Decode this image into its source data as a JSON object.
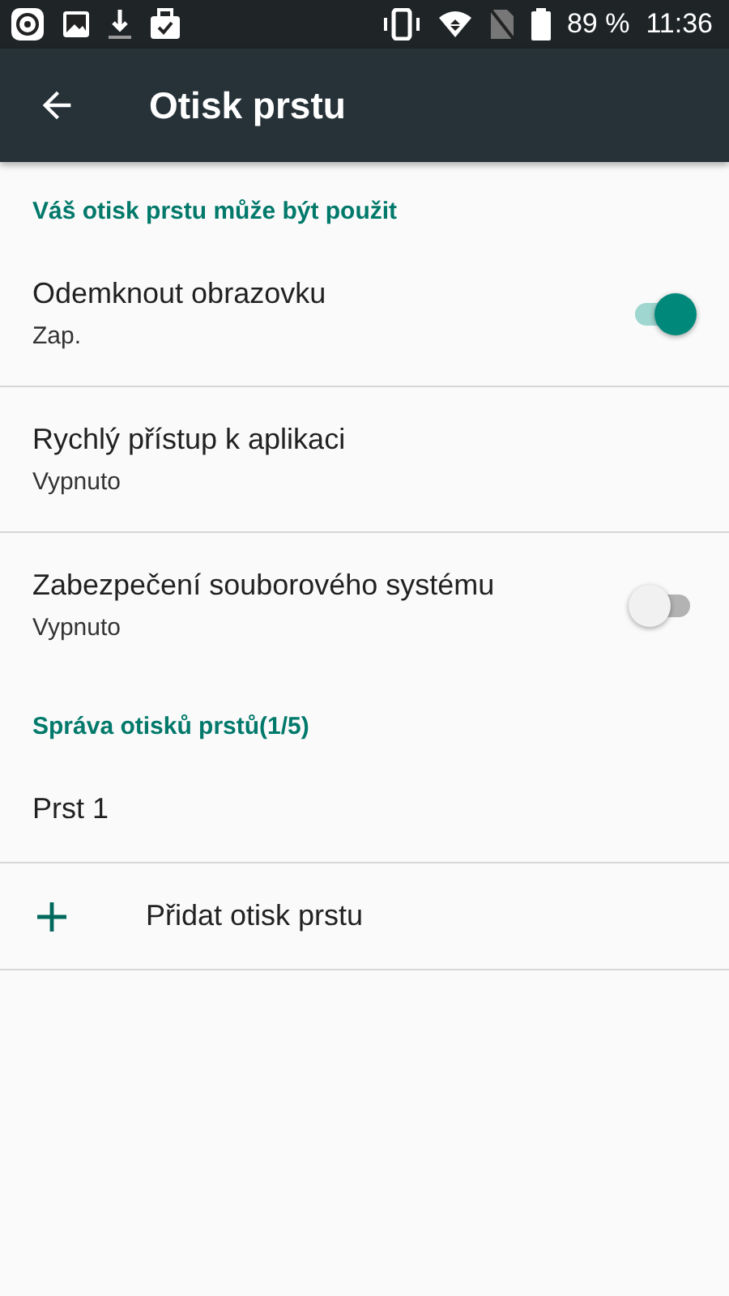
{
  "status_bar": {
    "battery": "89 %",
    "time": "11:36"
  },
  "toolbar": {
    "title": "Otisk prstu"
  },
  "sections": [
    {
      "header": "Váš otisk prstu může být použit",
      "items": [
        {
          "kind": "switch",
          "title": "Odemknout obrazovku",
          "summary": "Zap.",
          "on": true
        },
        {
          "kind": "plain",
          "title": "Rychlý přístup k aplikaci",
          "summary": "Vypnuto"
        },
        {
          "kind": "switch",
          "title": "Zabezpečení souborového systému",
          "summary": "Vypnuto",
          "on": false
        }
      ]
    },
    {
      "header": "Správa otisků prstů(1/5)",
      "items": [
        {
          "kind": "plain",
          "title": "Prst 1"
        },
        {
          "kind": "add",
          "title": "Přidat otisk prstu"
        }
      ]
    }
  ]
}
